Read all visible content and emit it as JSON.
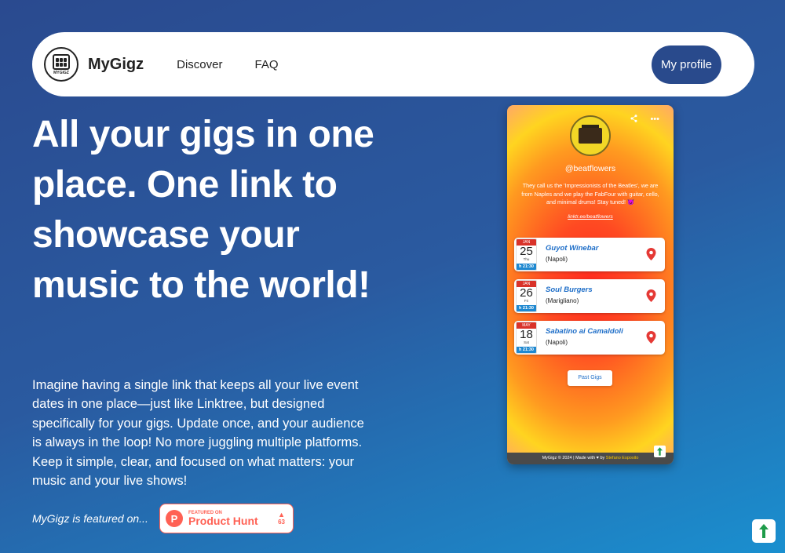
{
  "navbar": {
    "logo_small": "MYGIGZ",
    "brand": "MyGigz",
    "links": [
      "Discover",
      "FAQ"
    ],
    "profile_button": "My profile"
  },
  "hero": {
    "title": "All your gigs in one place. One link to showcase your music to the world!",
    "description": "Imagine having a single link that keeps all your live event dates in one place—just like Linktree, but designed specifically for your gigs. Update once, and your audience is always in the loop! No more juggling multiple platforms. Keep it simple, clear, and focused on what matters: your music and your live shows!",
    "featured_text": "MyGigz is featured on..."
  },
  "product_hunt": {
    "small": "FEATURED ON",
    "big": "Product Hunt",
    "votes": "63",
    "logo_letter": "P"
  },
  "phone": {
    "handle": "@beatflowers",
    "bio": "They call us the 'Impressionists of the Beatles', we are from Naples and we play the FabFour with guitar, cello, and minimal drums! Stay tuned! 😈",
    "link": "linktr.ee/beatflowers",
    "gigs": [
      {
        "month": "JAN",
        "day": "25",
        "dow": "Thu",
        "time": "h 21:30",
        "venue": "Guyot Winebar",
        "city": "(Napoli)"
      },
      {
        "month": "JAN",
        "day": "26",
        "dow": "Fri",
        "time": "h 21:30",
        "venue": "Soul Burgers",
        "city": "(Marigliano)"
      },
      {
        "month": "MAY",
        "day": "18",
        "dow": "Sat",
        "time": "h 21:30",
        "venue": "Sabatino ai Camaldoli",
        "city": "(Napoli)"
      }
    ],
    "past_gigs_button": "Past Gigs",
    "footer_text": "MyGigz © 2024 | Made with ♥ by ",
    "footer_author": "Stefano Esposito"
  },
  "colors": {
    "accent": "#294a8c",
    "ph": "#ff6154",
    "gig_link": "#1e6ec8",
    "pin": "#e53935",
    "scroll_arrow": "#1e9c4a"
  },
  "icons": {
    "share": "share-icon",
    "more": "more-icon",
    "pin": "map-pin-icon",
    "scroll_top": "arrow-up-icon"
  }
}
